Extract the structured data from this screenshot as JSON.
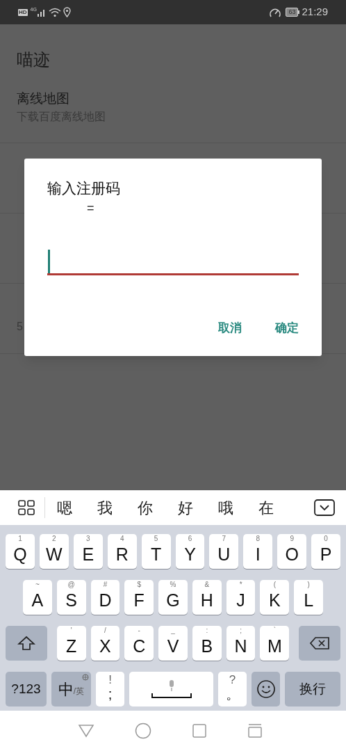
{
  "status_bar": {
    "hd": "HD",
    "network": "4G",
    "battery": "63",
    "time": "21:29"
  },
  "app_title": "喵迹",
  "settings": [
    {
      "kind": "full",
      "title": "离线地图",
      "subtitle": "下载百度离线地图"
    },
    {
      "kind": "covered"
    },
    {
      "kind": "covered"
    },
    {
      "kind": "covered",
      "subtitle": "5"
    }
  ],
  "dialog": {
    "title": "输入注册码",
    "message": "=",
    "buttons": [
      "取消",
      "确定"
    ]
  },
  "candidates": [
    "嗯",
    "我",
    "你",
    "好",
    "哦",
    "在"
  ],
  "keyboard": [
    [
      {
        "kind": "letter",
        "label": "Q",
        "hint": "1"
      },
      {
        "kind": "letter",
        "label": "W",
        "hint": "2"
      },
      {
        "kind": "letter",
        "label": "E",
        "hint": "3"
      },
      {
        "kind": "letter",
        "label": "R",
        "hint": "4"
      },
      {
        "kind": "letter",
        "label": "T",
        "hint": "5"
      },
      {
        "kind": "letter",
        "label": "Y",
        "hint": "6"
      },
      {
        "kind": "letter",
        "label": "U",
        "hint": "7"
      },
      {
        "kind": "letter",
        "label": "I",
        "hint": "8"
      },
      {
        "kind": "letter",
        "label": "O",
        "hint": "9"
      },
      {
        "kind": "letter",
        "label": "P",
        "hint": "0"
      }
    ],
    [
      {
        "kind": "letter",
        "label": "A",
        "hint": "~"
      },
      {
        "kind": "letter",
        "label": "S",
        "hint": "@"
      },
      {
        "kind": "letter",
        "label": "D",
        "hint": "#"
      },
      {
        "kind": "letter",
        "label": "F",
        "hint": "$"
      },
      {
        "kind": "letter",
        "label": "G",
        "hint": "%"
      },
      {
        "kind": "letter",
        "label": "H",
        "hint": "&"
      },
      {
        "kind": "letter",
        "label": "J",
        "hint": "*"
      },
      {
        "kind": "letter",
        "label": "K",
        "hint": "("
      },
      {
        "kind": "letter",
        "label": "L",
        "hint": ")"
      }
    ],
    [
      {
        "kind": "shift"
      },
      {
        "kind": "letter",
        "label": "Z",
        "hint": "'"
      },
      {
        "kind": "letter",
        "label": "X",
        "hint": "/"
      },
      {
        "kind": "letter",
        "label": "C",
        "hint": "-"
      },
      {
        "kind": "letter",
        "label": "V",
        "hint": "_"
      },
      {
        "kind": "letter",
        "label": "B",
        "hint": ":"
      },
      {
        "kind": "letter",
        "label": "N",
        "hint": ";"
      },
      {
        "kind": "letter",
        "label": "M",
        "hint": "`"
      },
      {
        "kind": "backspace"
      }
    ],
    [
      {
        "kind": "symbols",
        "label": "?123"
      },
      {
        "kind": "lang",
        "label": "中",
        "hint": "/英"
      },
      {
        "kind": "punct",
        "label": ";",
        "hint": "!"
      },
      {
        "kind": "space"
      },
      {
        "kind": "punct",
        "label": "。",
        "hint": "?"
      },
      {
        "kind": "emoji"
      },
      {
        "kind": "enter",
        "label": "换行"
      }
    ]
  ]
}
